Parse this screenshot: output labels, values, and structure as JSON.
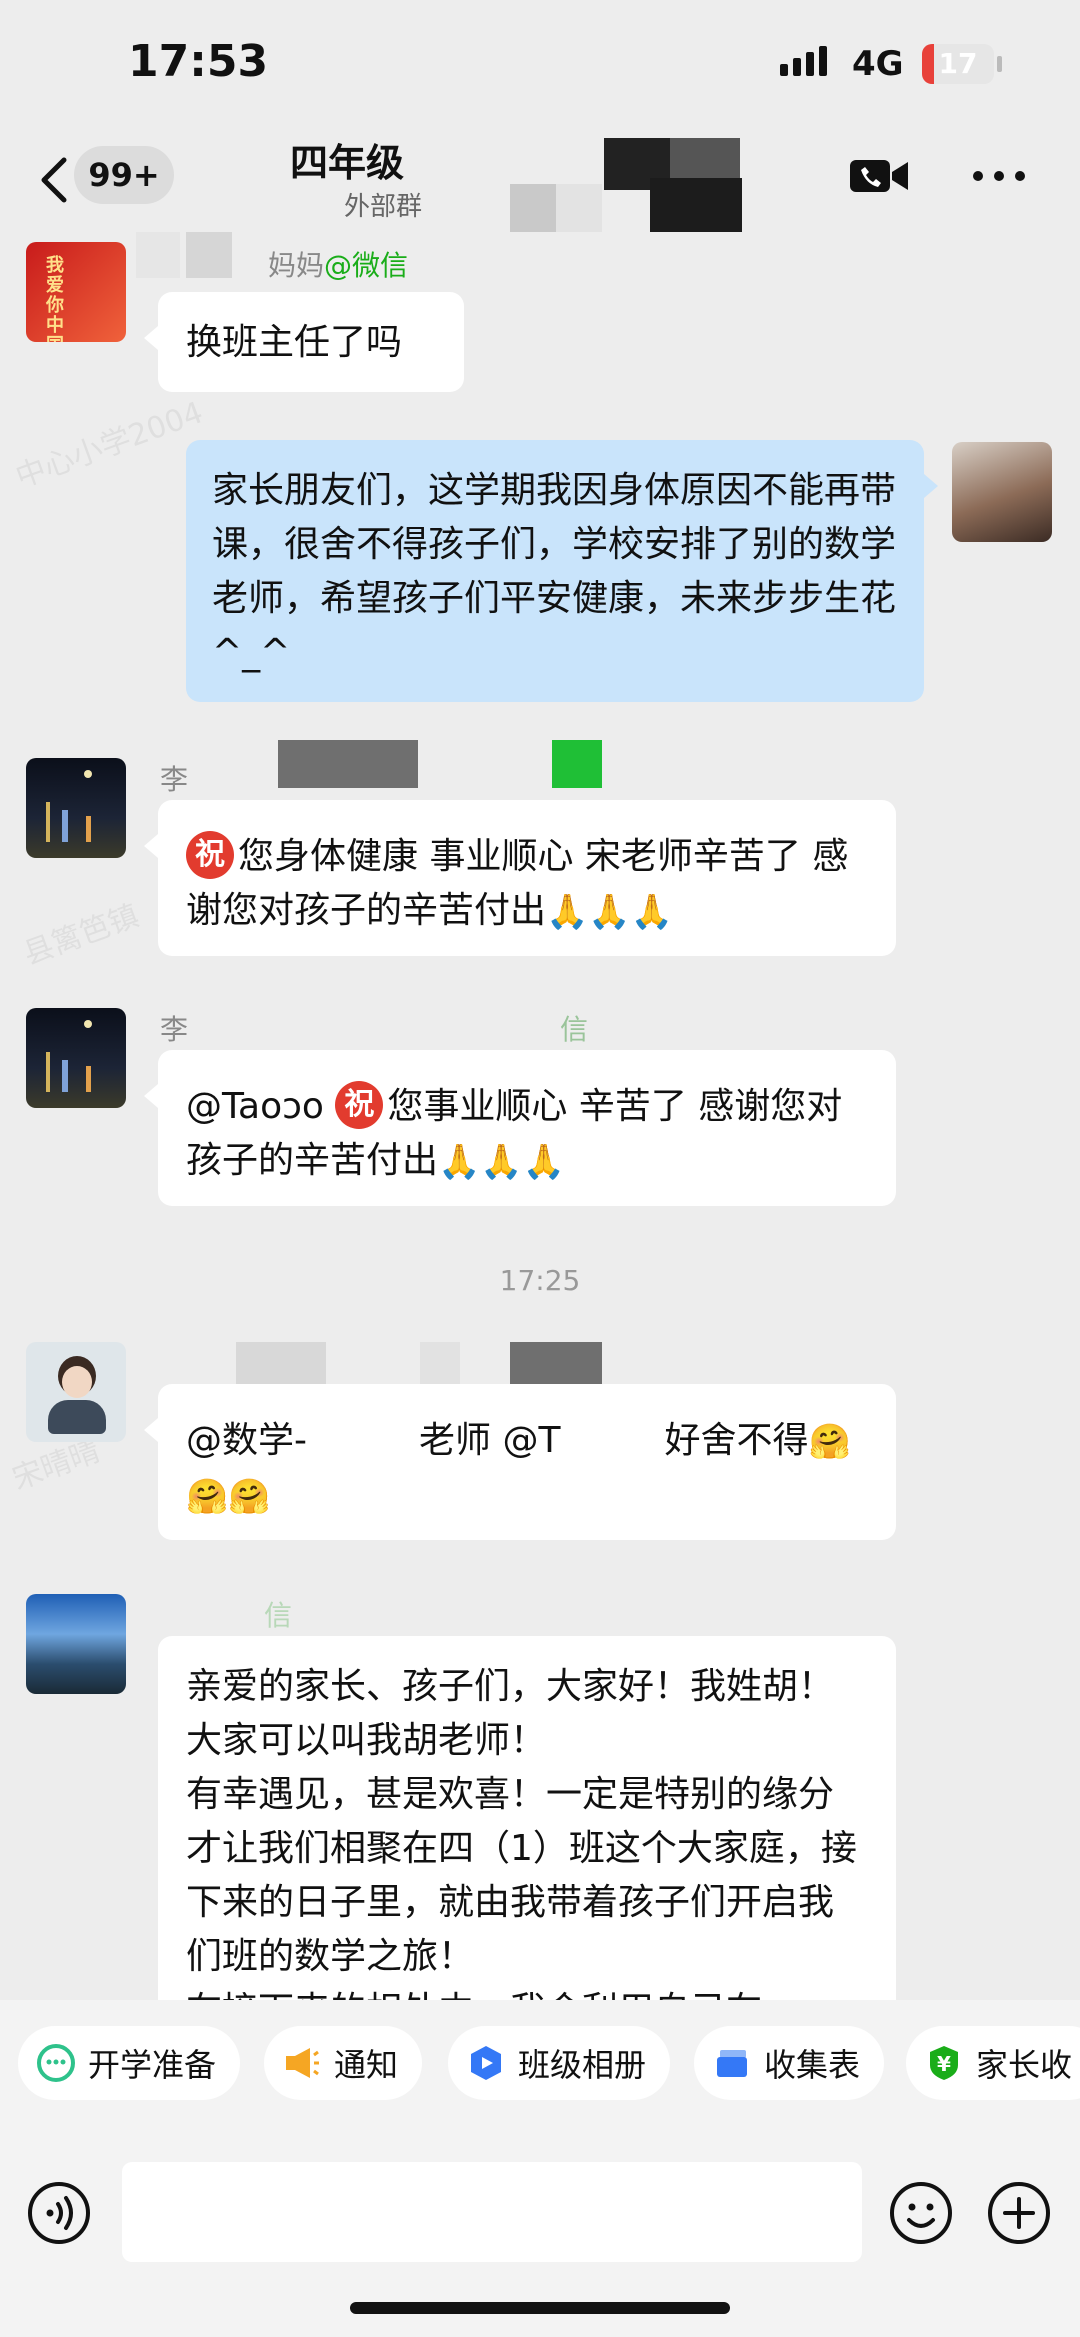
{
  "status_bar": {
    "time": "17:53",
    "network": "4G",
    "battery": "17",
    "battery_level_percent": 17
  },
  "nav": {
    "badge": "99+",
    "title": "四年级",
    "subtitle": "外部群"
  },
  "messages": [
    {
      "sender": "妈妈",
      "sender_tag": "@微信",
      "text": "换班主任了吗"
    },
    {
      "text": "家长朋友们，这学期我因身体原因不能再带课，很舍不得孩子们，学校安排了别的数学老师，希望孩子们平安健康，未来步步生花^_^"
    },
    {
      "sender": "李",
      "badge_char": "祝",
      "text": "您身体健康 事业顺心 宋老师辛苦了 感谢您对孩子的辛苦付出",
      "emoji": "🙏🙏🙏"
    },
    {
      "sender": "李",
      "sender_tag": "信",
      "mention": "@Taoɔo ",
      "badge_char": "祝",
      "text": "您事业顺心 辛苦了 感谢您对孩子的辛苦付出",
      "emoji": "🙏🙏🙏"
    },
    {
      "timestamp": "17:25"
    },
    {
      "part1": "@数学-",
      "part2": "老师 @T",
      "part3": "好舍不得",
      "emoji": "🤗🤗🤗"
    },
    {
      "sender_tag": "信",
      "text": "亲爱的家长、孩子们，大家好！我姓胡！大家可以叫我胡老师！\n有幸遇见，甚是欢喜！一定是特别的缘分才让我们相聚在四（1）班这个大家庭，接下来的日子里，就由我带着孩子们开启我们班的数学之旅！\n在接下来的相处中，我会利用自己在"
    }
  ],
  "watermarks": [
    "中心小学2004",
    "宋晴晴",
    "县篱笆镇"
  ],
  "quick_actions": [
    {
      "label": "开学准备",
      "icon": "chat-smile-icon",
      "color": "#2ec28b"
    },
    {
      "label": "通知",
      "icon": "megaphone-icon",
      "color": "#f5a623"
    },
    {
      "label": "班级相册",
      "icon": "album-icon",
      "color": "#3478f6"
    },
    {
      "label": "收集表",
      "icon": "collect-form-icon",
      "color": "#3478f6"
    },
    {
      "label": "家长收",
      "icon": "payment-icon",
      "color": "#1aad19"
    }
  ],
  "input": {
    "placeholder": ""
  }
}
